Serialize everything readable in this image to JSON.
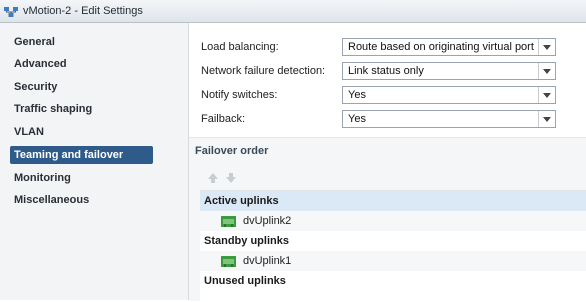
{
  "window": {
    "title": "vMotion-2 - Edit Settings",
    "icon": "network-settings-icon"
  },
  "sidebar": {
    "items": [
      {
        "label": "General",
        "selected": false
      },
      {
        "label": "Advanced",
        "selected": false
      },
      {
        "label": "Security",
        "selected": false
      },
      {
        "label": "Traffic shaping",
        "selected": false
      },
      {
        "label": "VLAN",
        "selected": false
      },
      {
        "label": "Teaming and failover",
        "selected": true
      },
      {
        "label": "Monitoring",
        "selected": false
      },
      {
        "label": "Miscellaneous",
        "selected": false
      }
    ]
  },
  "form": {
    "load_balancing": {
      "label": "Load balancing:",
      "value": "Route based on originating virtual port"
    },
    "network_failure_detection": {
      "label": "Network failure detection:",
      "value": "Link status only"
    },
    "notify_switches": {
      "label": "Notify switches:",
      "value": "Yes"
    },
    "failback": {
      "label": "Failback:",
      "value": "Yes"
    }
  },
  "failover": {
    "title": "Failover order",
    "move_up_icon": "arrow-up-icon",
    "move_down_icon": "arrow-down-icon",
    "groups": {
      "active": {
        "label": "Active uplinks",
        "uplinks": [
          "dvUplink2"
        ]
      },
      "standby": {
        "label": "Standby uplinks",
        "uplinks": [
          "dvUplink1"
        ]
      },
      "unused": {
        "label": "Unused uplinks",
        "uplinks": []
      }
    }
  },
  "colors": {
    "selected_nav": "#2e5b8a",
    "active_group_highlight": "#dbe8f6",
    "uplink_icon": "#3d9a3d"
  }
}
